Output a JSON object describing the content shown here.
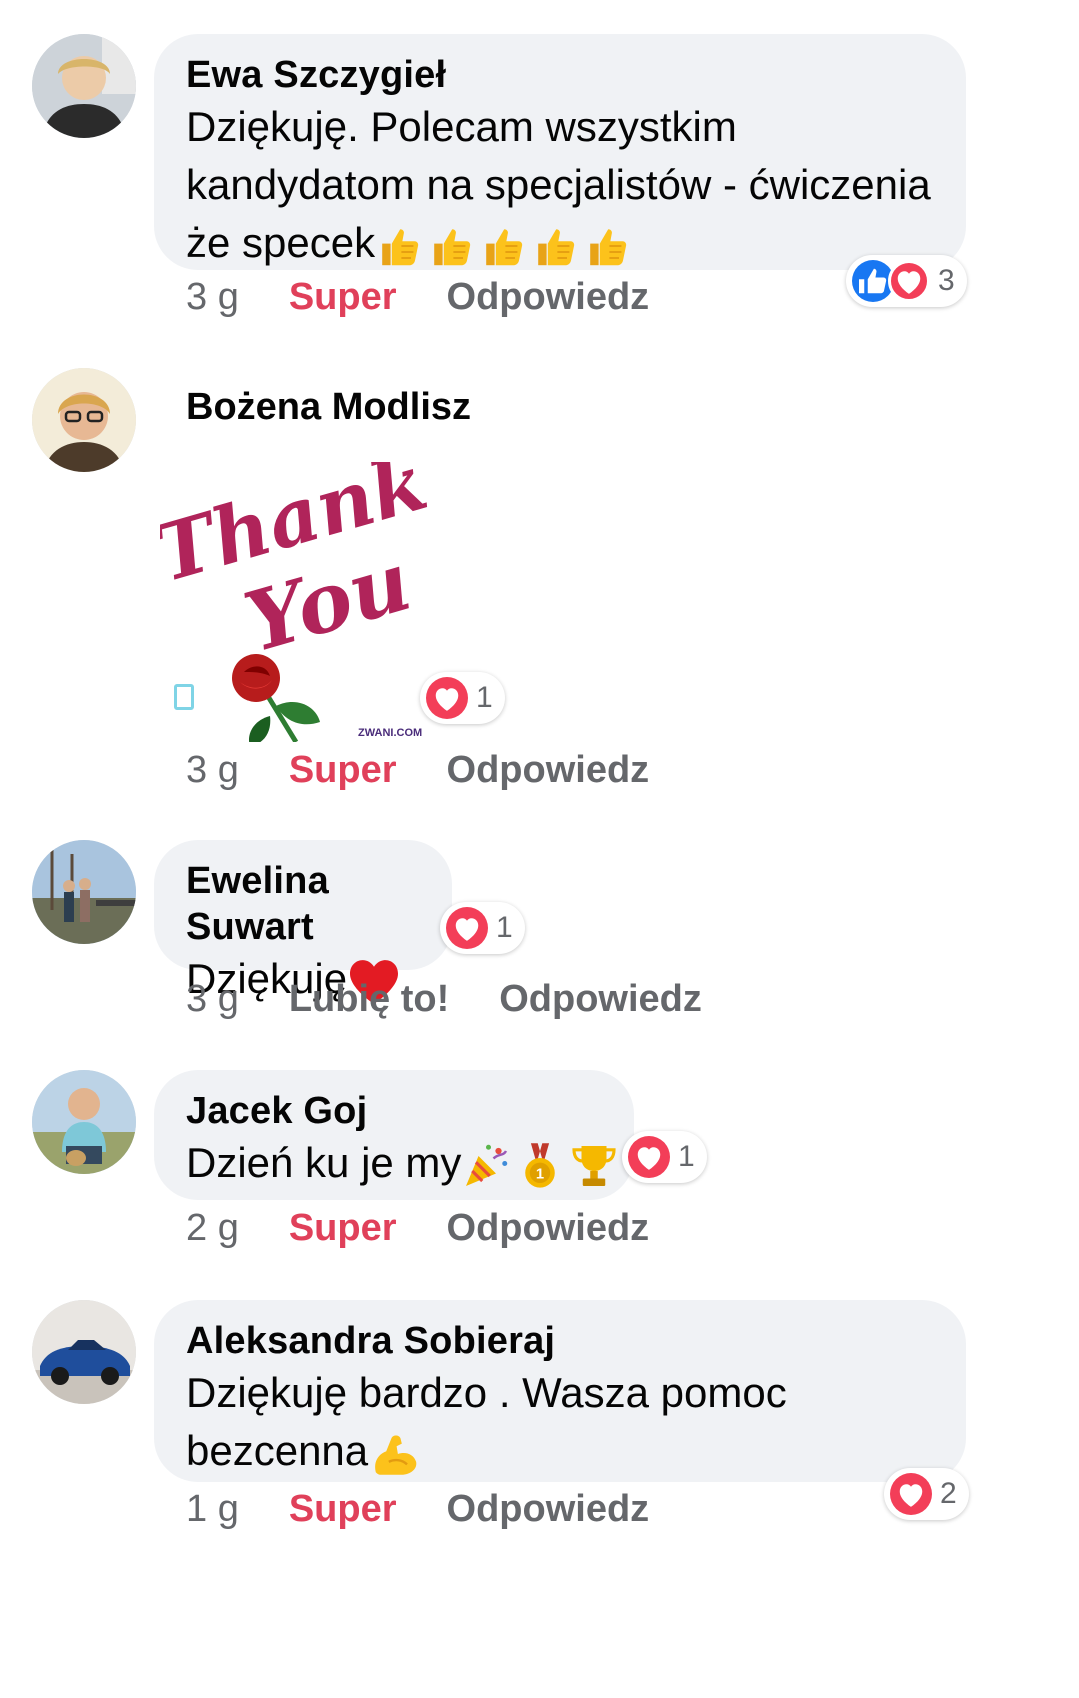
{
  "comments": [
    {
      "author": "Ewa Szczygieł",
      "line1": "Dziękuję. Polecam wszystkim",
      "line2": "kandydatom na specjalistów - ćwiczenia",
      "line3": "że specek",
      "time": "3 g",
      "reaction_label": "Super",
      "reply_label": "Odpowiedz",
      "reaction_count": "3",
      "reaction_icons": [
        "like-icon",
        "love-icon"
      ],
      "trailing_emoji": [
        "thumbs-up-icon",
        "thumbs-up-icon",
        "thumbs-up-icon",
        "thumbs-up-icon",
        "thumbs-up-icon"
      ]
    },
    {
      "author": "Bożena Modlisz",
      "sticker_text": "ZWANI.COM",
      "time": "3 g",
      "reaction_label": "Super",
      "reply_label": "Odpowiedz",
      "reaction_count": "1",
      "reaction_icons": [
        "love-icon"
      ]
    },
    {
      "author": "Ewelina Suwart",
      "text": "Dziękuję",
      "time": "3 g",
      "reaction_label": "Lubię to!",
      "reply_label": "Odpowiedz",
      "reaction_count": "1",
      "reaction_icons": [
        "love-icon"
      ],
      "trailing_emoji": [
        "red-heart-icon"
      ]
    },
    {
      "author": "Jacek Goj",
      "text": "Dzień ku je my",
      "time": "2 g",
      "reaction_label": "Super",
      "reply_label": "Odpowiedz",
      "reaction_count": "1",
      "reaction_icons": [
        "love-icon"
      ],
      "trailing_emoji": [
        "party-popper-icon",
        "medal-icon",
        "trophy-icon"
      ]
    },
    {
      "author": "Aleksandra Sobieraj",
      "line1": "Dziękuję bardzo . Wasza pomoc",
      "line2": "bezcenna",
      "time": "1 g",
      "reaction_label": "Super",
      "reply_label": "Odpowiedz",
      "reaction_count": "2",
      "reaction_icons": [
        "love-icon"
      ],
      "trailing_emoji": [
        "flexed-biceps-icon"
      ]
    }
  ],
  "colors": {
    "bubble": "#f0f2f5",
    "super": "#e0405a",
    "meta": "#65676b",
    "like": "#1877f2",
    "love": "#f33e58"
  }
}
